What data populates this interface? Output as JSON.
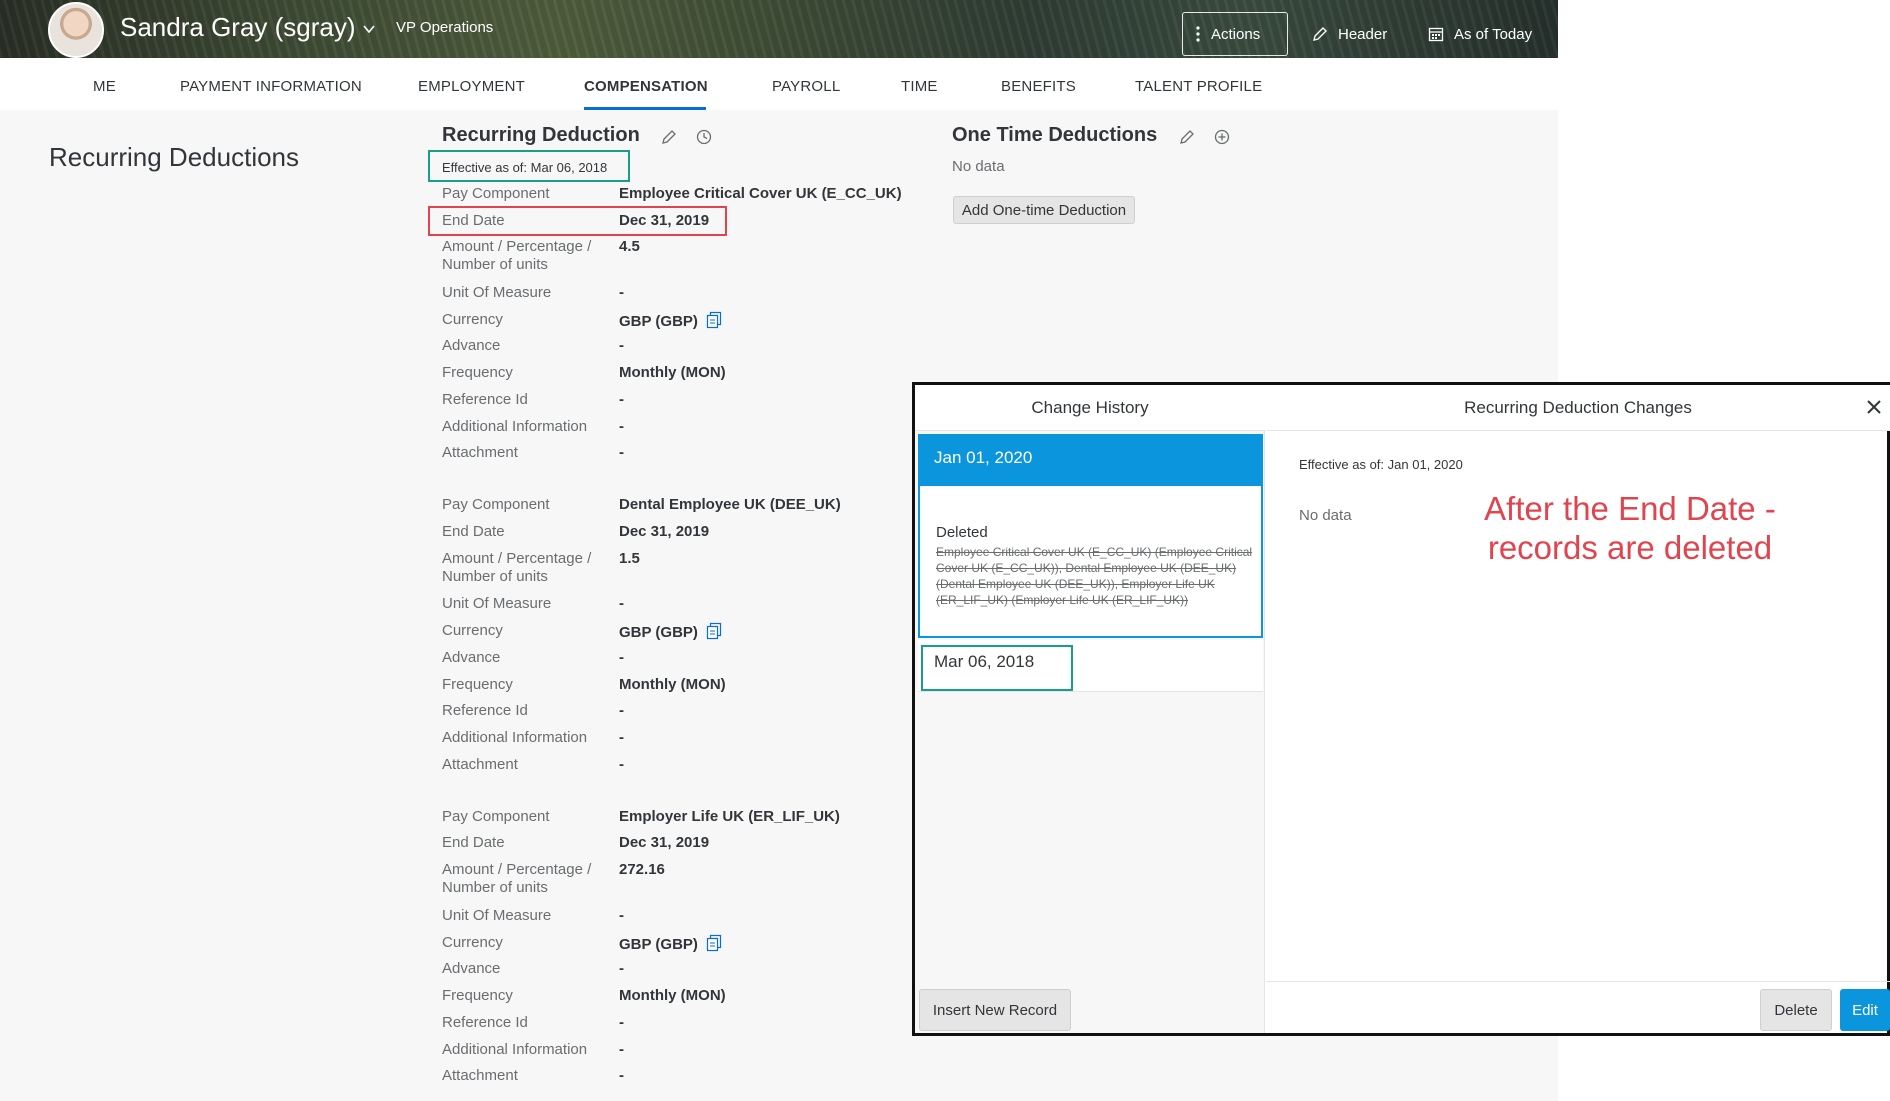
{
  "header": {
    "user_name": "Sandra Gray (sgray)",
    "user_title": "VP Operations",
    "actions_label": "Actions",
    "header_label": "Header",
    "as_of_label": "As of Today"
  },
  "tabs": [
    {
      "label": "ME"
    },
    {
      "label": "PAYMENT INFORMATION"
    },
    {
      "label": "EMPLOYMENT"
    },
    {
      "label": "COMPENSATION"
    },
    {
      "label": "PAYROLL"
    },
    {
      "label": "TIME"
    },
    {
      "label": "BENEFITS"
    },
    {
      "label": "TALENT PROFILE"
    }
  ],
  "active_tab": "COMPENSATION",
  "section_title": "Recurring Deductions",
  "recurring": {
    "title": "Recurring Deduction",
    "effective": "Effective as of: Mar 06, 2018",
    "labels": {
      "pay_component": "Pay Component",
      "end_date": "End Date",
      "amount_1": "Amount / Percentage /",
      "amount_2": "Number of units",
      "unit": "Unit Of Measure",
      "currency": "Currency",
      "advance": "Advance",
      "frequency": "Frequency",
      "reference": "Reference Id",
      "additional": "Additional Information",
      "attachment": "Attachment"
    },
    "records": [
      {
        "pay_component": "Employee Critical Cover UK (E_CC_UK)",
        "end_date": "Dec 31, 2019",
        "amount": "4.5",
        "unit": "-",
        "currency": "GBP (GBP)",
        "advance": "-",
        "frequency": "Monthly (MON)",
        "reference": "-",
        "additional": "-",
        "attachment": "-"
      },
      {
        "pay_component": "Dental Employee UK (DEE_UK)",
        "end_date": "Dec 31, 2019",
        "amount": "1.5",
        "unit": "-",
        "currency": "GBP (GBP)",
        "advance": "-",
        "frequency": "Monthly (MON)",
        "reference": "-",
        "additional": "-",
        "attachment": "-"
      },
      {
        "pay_component": "Employer Life UK (ER_LIF_UK)",
        "end_date": "Dec 31, 2019",
        "amount": "272.16",
        "unit": "-",
        "currency": "GBP (GBP)",
        "advance": "-",
        "frequency": "Monthly (MON)",
        "reference": "-",
        "additional": "-",
        "attachment": "-"
      }
    ]
  },
  "one_time": {
    "title": "One Time Deductions",
    "no_data": "No data",
    "add_button": "Add One-time Deduction"
  },
  "dialog": {
    "left_title": "Change History",
    "right_title": "Recurring Deduction Changes",
    "selected_date": "Jan 01, 2020",
    "deleted_label": "Deleted",
    "deleted_text": "Employee Critical Cover UK (E_CC_UK) (Employee Critical Cover UK (E_CC_UK)), Dental Employee UK (DEE_UK) (Dental Employee UK (DEE_UK)), Employer Life UK (ER_LIF_UK) (Employer Life UK (ER_LIF_UK))",
    "other_date": "Mar 06, 2018",
    "insert_button": "Insert New Record",
    "effective": "Effective as of: Jan 01, 2020",
    "no_data": "No data",
    "delete_button": "Delete",
    "edit_button": "Edit"
  },
  "annotation": {
    "line1": "After the End Date -",
    "line2": "records are deleted",
    "color": "#e0454f"
  },
  "colors": {
    "selection_blue": "#0a95dc",
    "highlight_green": "#1b9e87",
    "highlight_red": "#e0454f",
    "tab_underline": "#0a6ed1"
  }
}
